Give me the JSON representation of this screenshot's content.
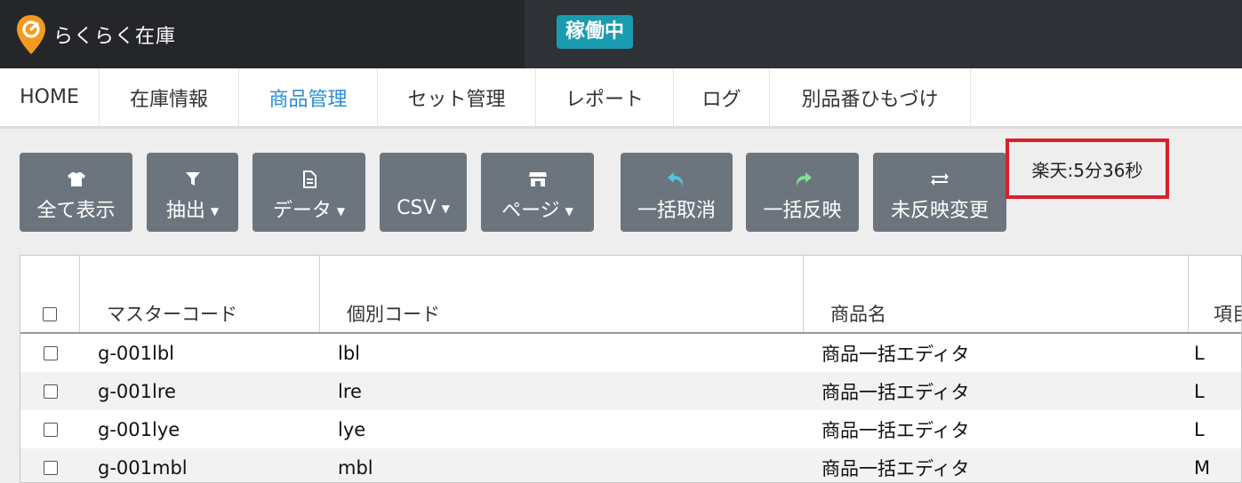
{
  "app": {
    "name": "らくらく在庫",
    "status": "稼働中"
  },
  "nav": [
    {
      "label": "HOME"
    },
    {
      "label": "在庫情報"
    },
    {
      "label": "商品管理",
      "active": true
    },
    {
      "label": "セット管理"
    },
    {
      "label": "レポート"
    },
    {
      "label": "ログ"
    },
    {
      "label": "別品番ひもづけ"
    }
  ],
  "toolbar": {
    "show_all": "全て表示",
    "extract": "抽出",
    "data": "データ",
    "csv": "CSV",
    "page": "ページ",
    "bulk_cancel": "一括取消",
    "bulk_apply": "一括反映",
    "unapplied_change": "未反映変更",
    "timer": "楽天:5分36秒"
  },
  "colors": {
    "accent": "#2b8fd0",
    "status": "#1a9bb0",
    "undo_icon": "#4fc6e0",
    "redo_icon": "#7ee08a",
    "highlight": "#d9202a"
  },
  "table": {
    "headers": [
      "マスターコード",
      "個別コード",
      "商品名",
      "項目"
    ],
    "rows": [
      [
        "g-001lbl",
        "lbl",
        "商品一括エディタ",
        "L"
      ],
      [
        "g-001lre",
        "lre",
        "商品一括エディタ",
        "L"
      ],
      [
        "g-001lye",
        "lye",
        "商品一括エディタ",
        "L"
      ],
      [
        "g-001mbl",
        "mbl",
        "商品一括エディタ",
        "M"
      ]
    ]
  }
}
